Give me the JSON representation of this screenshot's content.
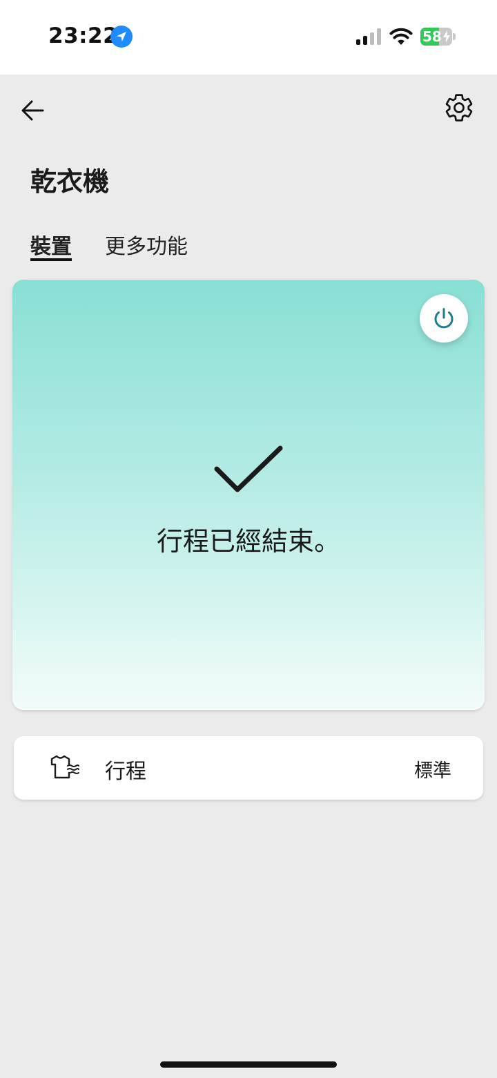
{
  "status_bar": {
    "time": "23:22",
    "battery_percent": 58,
    "battery_label": "58",
    "icons": [
      "location-arrow-icon",
      "cellular-signal-icon",
      "wifi-icon",
      "battery-charging-icon"
    ]
  },
  "header": {
    "back_icon": "arrow-left-icon",
    "settings_icon": "gear-icon",
    "title": "乾衣機"
  },
  "tabs": [
    {
      "label": "裝置",
      "active": true
    },
    {
      "label": "更多功能",
      "active": false
    }
  ],
  "status_card": {
    "power_icon": "power-icon",
    "status_icon": "checkmark-icon",
    "message": "行程已經結束。",
    "gradient_top": "#88dfd4",
    "gradient_bottom": "#f2fcfa"
  },
  "cycle": {
    "icon": "shirt-dry-icon",
    "label": "行程",
    "value": "標準"
  },
  "colors": {
    "background": "#ebebeb",
    "accent_teal": "#1e7d8a",
    "location_blue": "#1f8bff",
    "battery_green": "#34c759"
  }
}
